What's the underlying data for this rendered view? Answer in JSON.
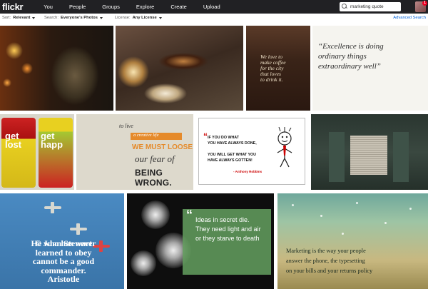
{
  "header": {
    "logo": "flickr",
    "nav": [
      "You",
      "People",
      "Groups",
      "Explore",
      "Create",
      "Upload"
    ],
    "search_value": "marketing quote",
    "notification_count": "1"
  },
  "filters": {
    "sort_label": "Sort:",
    "sort_value": "Relevant",
    "search_label": "Search:",
    "search_value": "Everyone's Photos",
    "license_label": "License:",
    "license_value": "Any License",
    "advanced_link": "Advanced Search"
  },
  "photos": {
    "p3_text": "We love to\nmake coffee\nfor the city\nthat loves\nto drink it.",
    "p4_text": "“Excellence is doing\nordinary things\nextraordinary well”",
    "p5_can1": "get\nlost",
    "p5_can2": "get\nhapp",
    "p6_line1": "to live",
    "p6_line2": "a creative life",
    "p6_line3": "WE MUST LOOSE",
    "p6_line4": "our fear of",
    "p6_line5": "BEING WRONG.",
    "p7_text": "IF YOU DO WHAT\nYOU HAVE ALWAYS DONE,\n\nYOU WILL GET WHAT YOU\nHAVE ALWAYS GOTTEN!",
    "p7_author": "- Anthony Robbins",
    "p9_credit": "© Juan Stewart",
    "p9_text": "He who has never\nlearned to obey\ncannot be a good\ncommander.\nAristotle",
    "p10_text": "Ideas in secret die.\nThey need light and air\nor they starve to death",
    "p11_text": "Marketing is the way your people\nanswer the phone, the typesetting\non your bills and your returns policy"
  }
}
